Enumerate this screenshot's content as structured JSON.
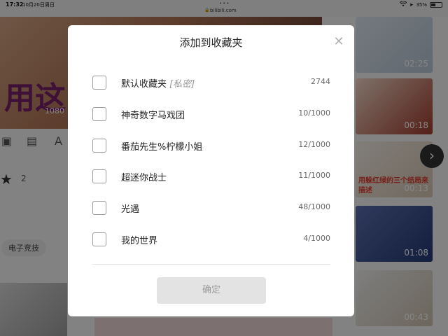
{
  "status_bar": {
    "time": "17:32",
    "date": "10月20日周日",
    "url": "bilibili.com",
    "battery": "35%"
  },
  "background": {
    "hero_text": "用这",
    "hero_resolution": "1080",
    "like_count": "2",
    "tag": "电子竞技",
    "right_column": {
      "durations": [
        "02:25",
        "00:18",
        "00:13",
        "01:08",
        "00:43"
      ],
      "thumb3_text": "用躲红绿的三个结局来描述"
    }
  },
  "modal": {
    "title": "添加到收藏夹",
    "folders": [
      {
        "name": "默认收藏夹",
        "private_label": "[私密]",
        "count": "2744"
      },
      {
        "name": "神奇数字马戏团",
        "private_label": "",
        "count": "10/1000"
      },
      {
        "name": "番茄先生%柠檬小姐",
        "private_label": "",
        "count": "12/1000"
      },
      {
        "name": "超迷你战士",
        "private_label": "",
        "count": "11/1000"
      },
      {
        "name": "光遇",
        "private_label": "",
        "count": "48/1000"
      },
      {
        "name": "我的世界",
        "private_label": "",
        "count": "4/1000"
      }
    ],
    "confirm_label": "确定"
  },
  "icons": {
    "close": "close-icon",
    "checkbox": "checkbox-icon",
    "star": "star-icon",
    "next": "chevron-right-icon",
    "wifi": "wifi-icon",
    "battery": "battery-icon"
  },
  "colors": {
    "overlay": "#000000",
    "confirm_disabled_bg": "#e3e3e3",
    "checkbox_border": "#9a9a9a"
  }
}
